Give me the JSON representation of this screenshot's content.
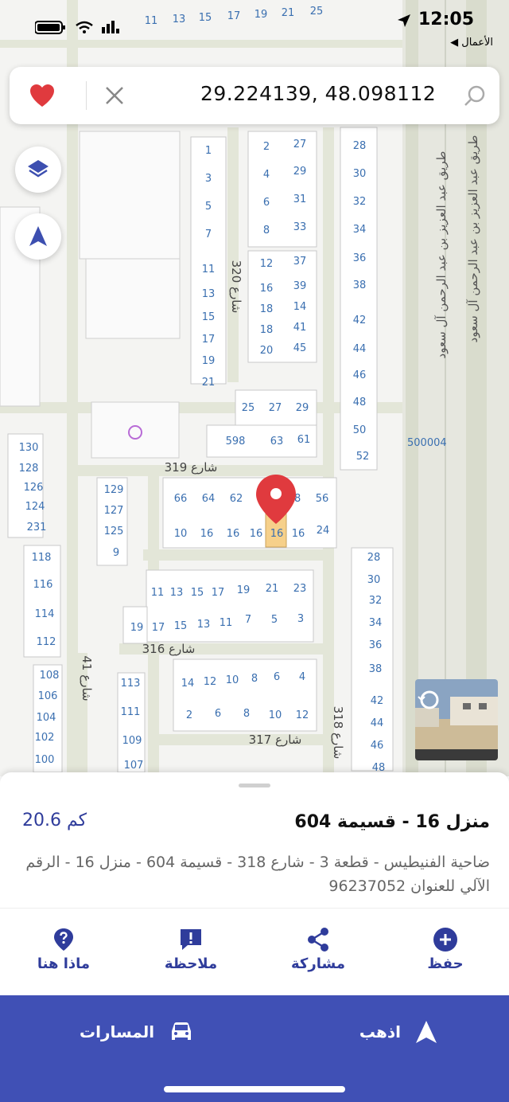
{
  "status_bar": {
    "time": "12:05",
    "back_app": "◀ الأعمال"
  },
  "search": {
    "query": "29.224139, 48.098112"
  },
  "map": {
    "highway_label_1": "طريق عبد العزيز بن عبد الرحمن آل سعود",
    "highway_label_2": "طريق عبد العزيز بن عبد الرحمن آل سعود",
    "plot_label": "500004",
    "streets": {
      "s320": "شارع 320",
      "s319": "شارع 319",
      "s316": "شارع 316",
      "s317": "شارع 317",
      "s318": "شارع 318",
      "s41": "شارع 41"
    }
  },
  "place": {
    "title": "منزل 16 - قسيمة 604",
    "distance": "20.6 كم",
    "address": "ضاحية الفنيطيس - قطعة 3 - شارع 318 - قسيمة 604 - منزل 16 - الرقم الآلي للعنوان 96237052"
  },
  "actions": {
    "save": "حفظ",
    "share": "مشاركة",
    "note": "ملاحظة",
    "whats_here": "ماذا هنا"
  },
  "bottom": {
    "go": "اذهب",
    "routes": "المسارات"
  },
  "colors": {
    "accent": "#4050b5",
    "pin": "#e03a3e",
    "lot_text": "#3a6fb0",
    "highlight": "#f6d08a"
  }
}
